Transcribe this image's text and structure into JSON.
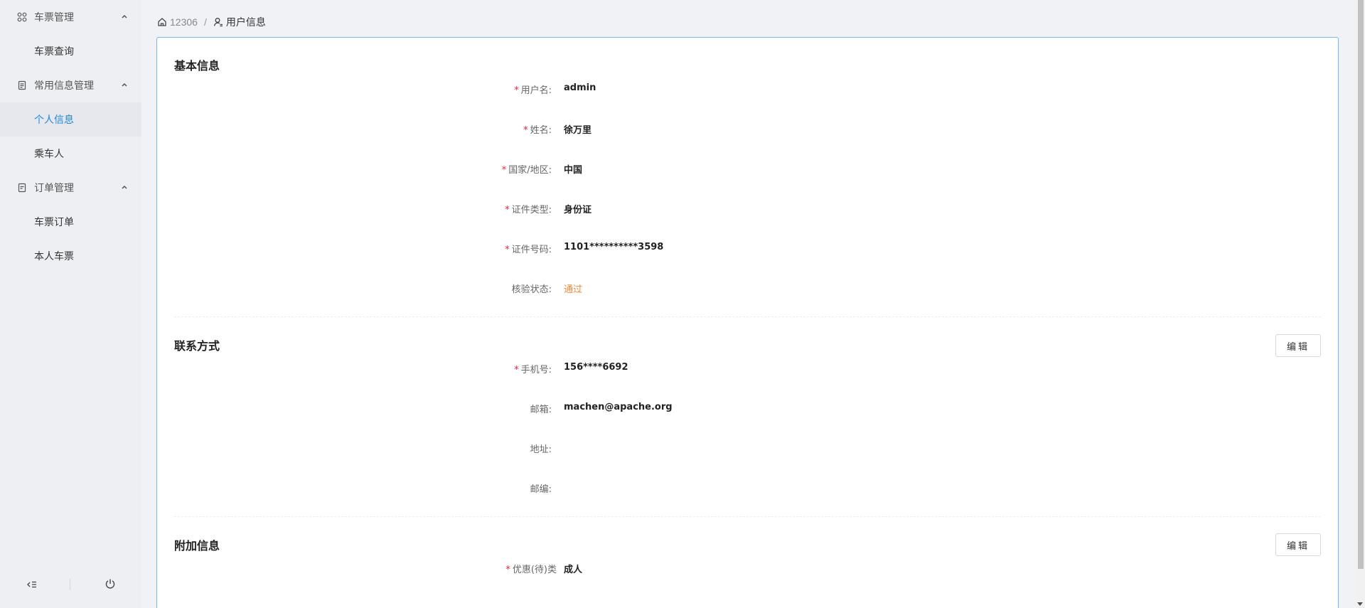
{
  "sidebar": {
    "groups": [
      {
        "label": "车票管理",
        "icon": "apps-icon",
        "items": [
          {
            "label": "车票查询",
            "active": false
          }
        ]
      },
      {
        "label": "常用信息管理",
        "icon": "document-icon",
        "items": [
          {
            "label": "个人信息",
            "active": true
          },
          {
            "label": "乘车人",
            "active": false
          }
        ]
      },
      {
        "label": "订单管理",
        "icon": "order-icon",
        "items": [
          {
            "label": "车票订单",
            "active": false
          },
          {
            "label": "本人车票",
            "active": false
          }
        ]
      }
    ]
  },
  "breadcrumb": {
    "home": "12306",
    "separator": "/",
    "current": "用户信息"
  },
  "sections": {
    "basic": {
      "title": "基本信息",
      "fields": [
        {
          "label": "用户名:",
          "required": true,
          "value": "admin"
        },
        {
          "label": "姓名:",
          "required": true,
          "value": "徐万里"
        },
        {
          "label": "国家/地区:",
          "required": true,
          "value": "中国"
        },
        {
          "label": "证件类型:",
          "required": true,
          "value": "身份证"
        },
        {
          "label": "证件号码:",
          "required": true,
          "value": "1101**********3598"
        },
        {
          "label": "核验状态:",
          "required": false,
          "value": "通过"
        }
      ]
    },
    "contact": {
      "title": "联系方式",
      "edit_label": "编辑",
      "fields": [
        {
          "label": "手机号:",
          "required": true,
          "value": "156****6692"
        },
        {
          "label": "邮箱:",
          "required": false,
          "value": "machen@apache.org"
        },
        {
          "label": "地址:",
          "required": false,
          "value": ""
        },
        {
          "label": "邮编:",
          "required": false,
          "value": ""
        }
      ]
    },
    "extra": {
      "title": "附加信息",
      "edit_label": "编辑",
      "fields": [
        {
          "label": "优惠(待)类",
          "required": true,
          "value": "成人"
        }
      ]
    }
  },
  "colors": {
    "accent": "#1e88e5",
    "required": "#f5222d",
    "pass": "#f0883e",
    "card_border": "#7ab7ee"
  }
}
